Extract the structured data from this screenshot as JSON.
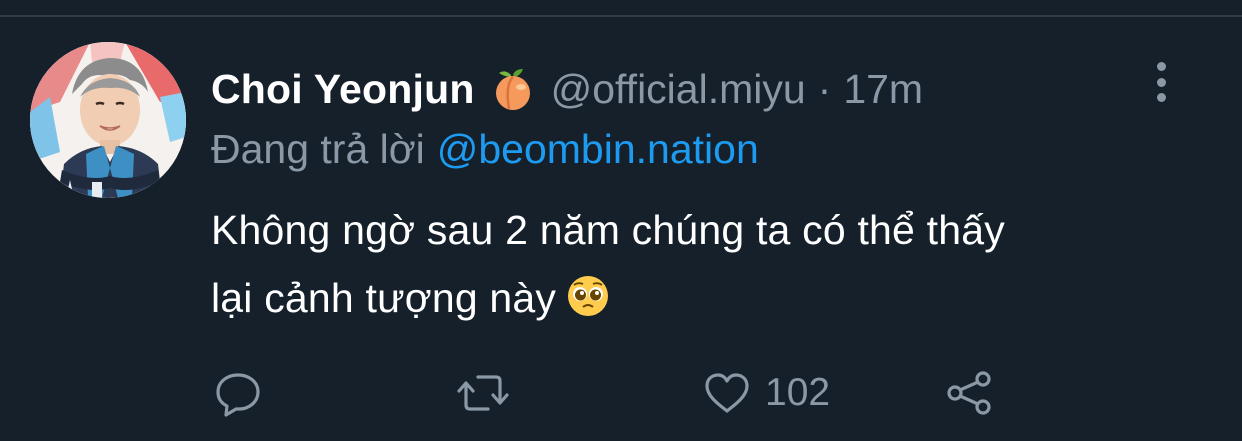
{
  "tweet": {
    "author": {
      "display_name": "Choi Yeonjun",
      "name_emoji": "peach-emoji",
      "handle": "@official.miyu",
      "separator": "·",
      "time_ago": "17m"
    },
    "reply_context": {
      "prefix": "Đang trả lời",
      "mention": "@beombin.nation"
    },
    "text_lines": [
      "Không ngờ sau 2 năm chúng ta có thể thấy",
      "lại cảnh tượng này"
    ],
    "text_emoji": "pleading-face-emoji",
    "actions": {
      "reply_icon": "reply-icon",
      "retweet_icon": "retweet-icon",
      "like_icon": "heart-icon",
      "like_count": "102",
      "share_icon": "share-icon"
    }
  },
  "colors": {
    "background": "#15202b",
    "primary_text": "#ffffff",
    "secondary_text": "#8b98a5",
    "link": "#1d9bf0"
  }
}
